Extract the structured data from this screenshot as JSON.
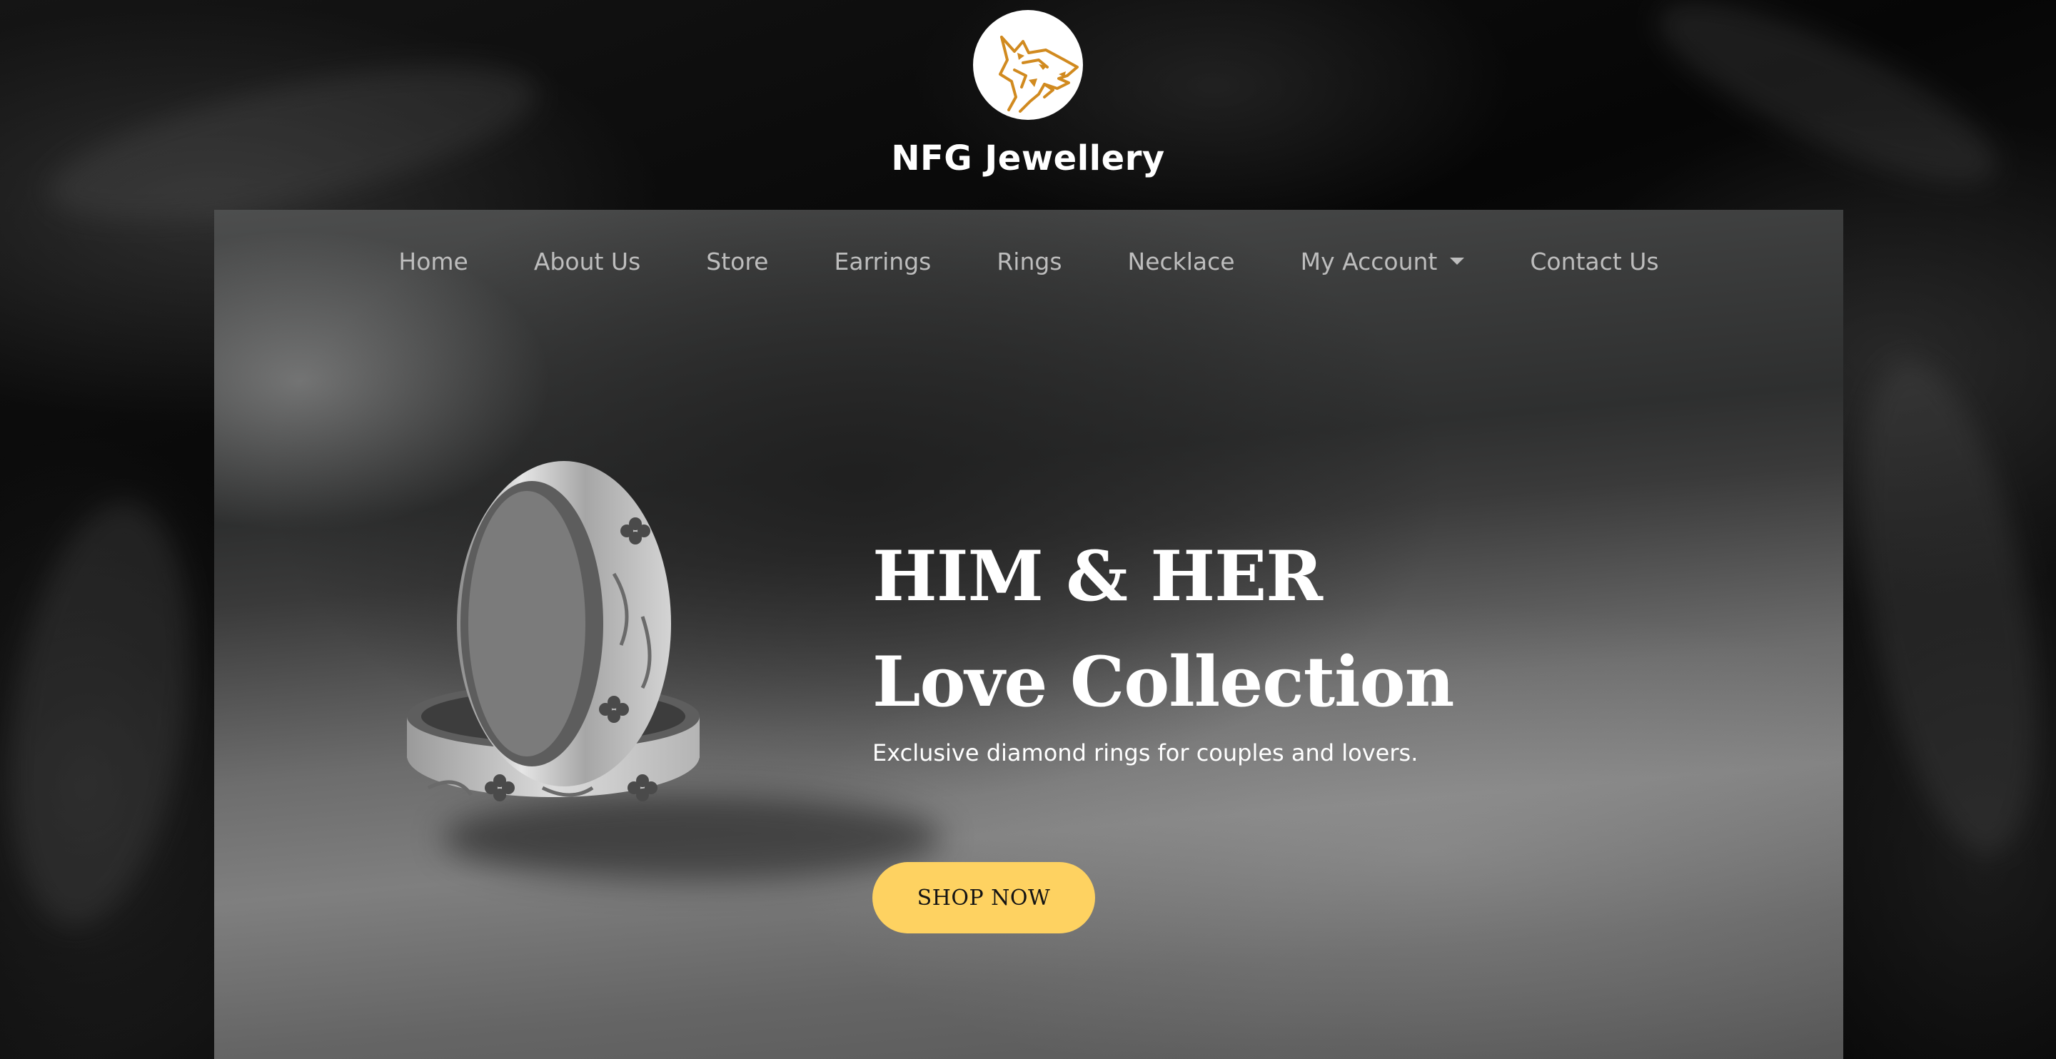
{
  "brand": {
    "name": "NFG Jewellery",
    "logo_icon": "wolf-head-icon",
    "logo_color": "#d18a1f"
  },
  "nav": {
    "items": [
      {
        "label": "Home"
      },
      {
        "label": "About Us"
      },
      {
        "label": "Store"
      },
      {
        "label": "Earrings"
      },
      {
        "label": "Rings"
      },
      {
        "label": "Necklace"
      },
      {
        "label": "My Account",
        "has_dropdown": true,
        "dropdown_icon": "caret-down-icon"
      },
      {
        "label": "Contact Us"
      }
    ]
  },
  "hero": {
    "title_line1": "HIM & HER",
    "title_line2": "Love Collection",
    "subtitle": "Exclusive diamond rings for couples and lovers.",
    "cta_label": "SHOP NOW",
    "cta_color": "#fed261",
    "image_subject": "pair-of-silver-rings"
  },
  "colors": {
    "background": "#050505",
    "nav_text": "#bdbdbd",
    "hero_text": "#ffffff"
  }
}
